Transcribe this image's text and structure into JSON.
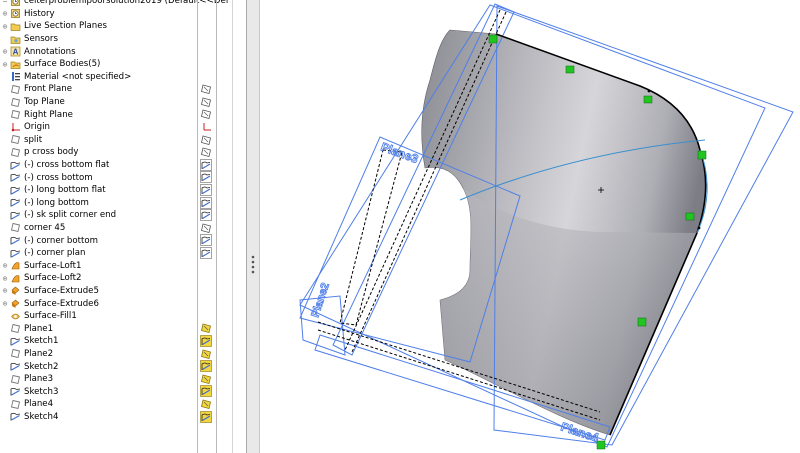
{
  "feature_tree": {
    "header_text": "ceiterproblemipoorsolution2019 (Default<<Def",
    "items": [
      {
        "label": "History",
        "icon": "history-icon",
        "expander": "+",
        "status": []
      },
      {
        "label": "Live Section Planes",
        "icon": "folder-icon",
        "expander": "+",
        "status": []
      },
      {
        "label": "Sensors",
        "icon": "sensor-icon",
        "expander": "",
        "status": []
      },
      {
        "label": "Annotations",
        "icon": "annotations-icon",
        "expander": "+",
        "status": []
      },
      {
        "label": "Surface Bodies(5)",
        "icon": "surface-bodies-icon",
        "expander": "+",
        "status": []
      },
      {
        "label": "Material <not specified>",
        "icon": "material-icon",
        "expander": "",
        "status": []
      },
      {
        "label": "Front Plane",
        "icon": "plane-icon",
        "expander": "",
        "status": [
          "plane"
        ]
      },
      {
        "label": "Top Plane",
        "icon": "plane-icon",
        "expander": "",
        "status": [
          "plane"
        ]
      },
      {
        "label": "Right Plane",
        "icon": "plane-icon",
        "expander": "",
        "status": [
          "plane"
        ]
      },
      {
        "label": "Origin",
        "icon": "origin-icon",
        "expander": "",
        "status": [
          "origin"
        ]
      },
      {
        "label": "split",
        "icon": "plane-icon",
        "expander": "",
        "status": [
          "plane"
        ]
      },
      {
        "label": "p cross body",
        "icon": "plane-icon",
        "expander": "",
        "status": [
          "plane"
        ]
      },
      {
        "label": "(-) cross bottom flat",
        "icon": "sketch-icon",
        "expander": "",
        "status": [
          "sketch"
        ]
      },
      {
        "label": "(-) cross bottom",
        "icon": "sketch-icon",
        "expander": "",
        "status": [
          "sketch"
        ]
      },
      {
        "label": "(-) long bottom flat",
        "icon": "sketch-icon",
        "expander": "",
        "status": [
          "sketch"
        ]
      },
      {
        "label": "(-) long bottom",
        "icon": "sketch-icon",
        "expander": "",
        "status": [
          "sketch"
        ]
      },
      {
        "label": "(-) sk split corner end",
        "icon": "sketch-icon",
        "expander": "",
        "status": [
          "sketch"
        ]
      },
      {
        "label": "corner 45",
        "icon": "plane-icon",
        "expander": "",
        "status": [
          "plane"
        ]
      },
      {
        "label": "(-) corner bottom",
        "icon": "sketch-icon",
        "expander": "",
        "status": [
          "sketch"
        ]
      },
      {
        "label": "(-) corner plan",
        "icon": "sketch-icon",
        "expander": "",
        "status": [
          "sketch"
        ]
      },
      {
        "label": "Surface-Loft1",
        "icon": "loft-icon",
        "expander": "+",
        "status": []
      },
      {
        "label": "Surface-Loft2",
        "icon": "loft-icon",
        "expander": "+",
        "status": []
      },
      {
        "label": "Surface-Extrude5",
        "icon": "extrude-icon",
        "expander": "+",
        "status": []
      },
      {
        "label": "Surface-Extrude6",
        "icon": "extrude-icon",
        "expander": "+",
        "status": []
      },
      {
        "label": "Surface-Fill1",
        "icon": "fill-icon",
        "expander": "",
        "status": []
      },
      {
        "label": "Plane1",
        "icon": "plane-icon",
        "expander": "",
        "status": [
          "plane-yellow"
        ]
      },
      {
        "label": "Sketch1",
        "icon": "sketch-icon",
        "expander": "",
        "status": [
          "sketch-yellow"
        ]
      },
      {
        "label": "Plane2",
        "icon": "plane-icon",
        "expander": "",
        "status": [
          "plane-yellow"
        ]
      },
      {
        "label": "Sketch2",
        "icon": "sketch-icon",
        "expander": "",
        "status": [
          "sketch-yellow"
        ]
      },
      {
        "label": "Plane3",
        "icon": "plane-icon",
        "expander": "",
        "status": [
          "plane-yellow"
        ]
      },
      {
        "label": "Sketch3",
        "icon": "sketch-icon",
        "expander": "",
        "status": [
          "sketch-yellow"
        ]
      },
      {
        "label": "Plane4",
        "icon": "plane-icon",
        "expander": "",
        "status": [
          "plane-yellow"
        ]
      },
      {
        "label": "Sketch4",
        "icon": "sketch-icon",
        "expander": "",
        "status": [
          "sketch-yellow"
        ]
      }
    ]
  },
  "viewport": {
    "plane_labels": [
      "Plane3",
      "Plane2",
      "Plane4"
    ],
    "colors": {
      "surface_light": "#c9c9ce",
      "surface_dark": "#7a7a82",
      "plane_outline": "#4f7fe8",
      "sketch_line": "#000000",
      "relation_marker": "#22c422",
      "curve": "#3a8fd0"
    }
  },
  "colors": {
    "plane_icon": "#7a7a7a",
    "sketch_icon": "#3c6fd6",
    "accent_yellow": "#e8c21c",
    "origin_red": "#c42020"
  }
}
